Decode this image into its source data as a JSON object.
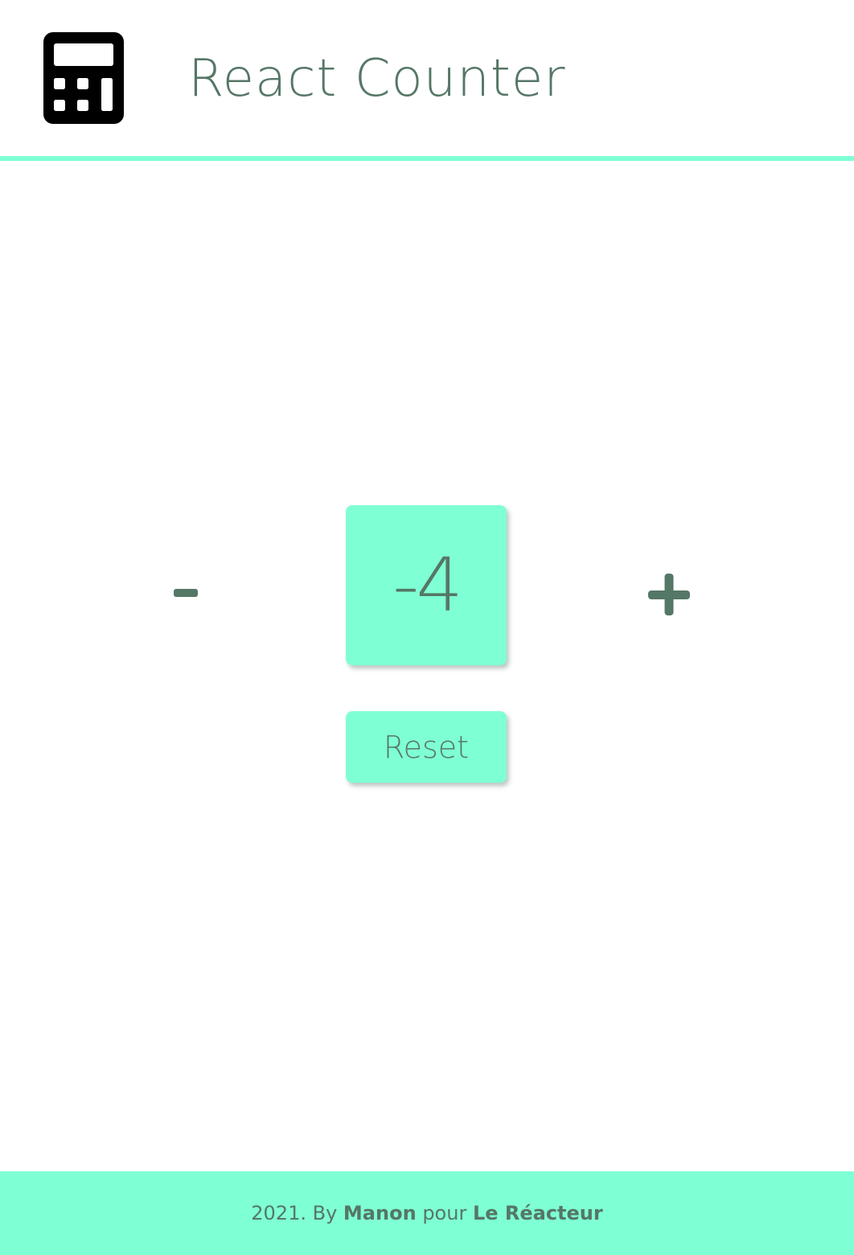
{
  "colors": {
    "accent": "#7fffd4",
    "text": "#557766",
    "icon": "#000000",
    "background": "#ffffff"
  },
  "header": {
    "logo_icon": "calculator-icon",
    "title": "React Counter"
  },
  "counter": {
    "value": "-4",
    "decrement_label": "-",
    "increment_label": "+",
    "reset_label": "Reset"
  },
  "footer": {
    "year_text": "2021. By",
    "author": "Manon",
    "middle_text": "pour",
    "school": "Le Réacteur"
  }
}
